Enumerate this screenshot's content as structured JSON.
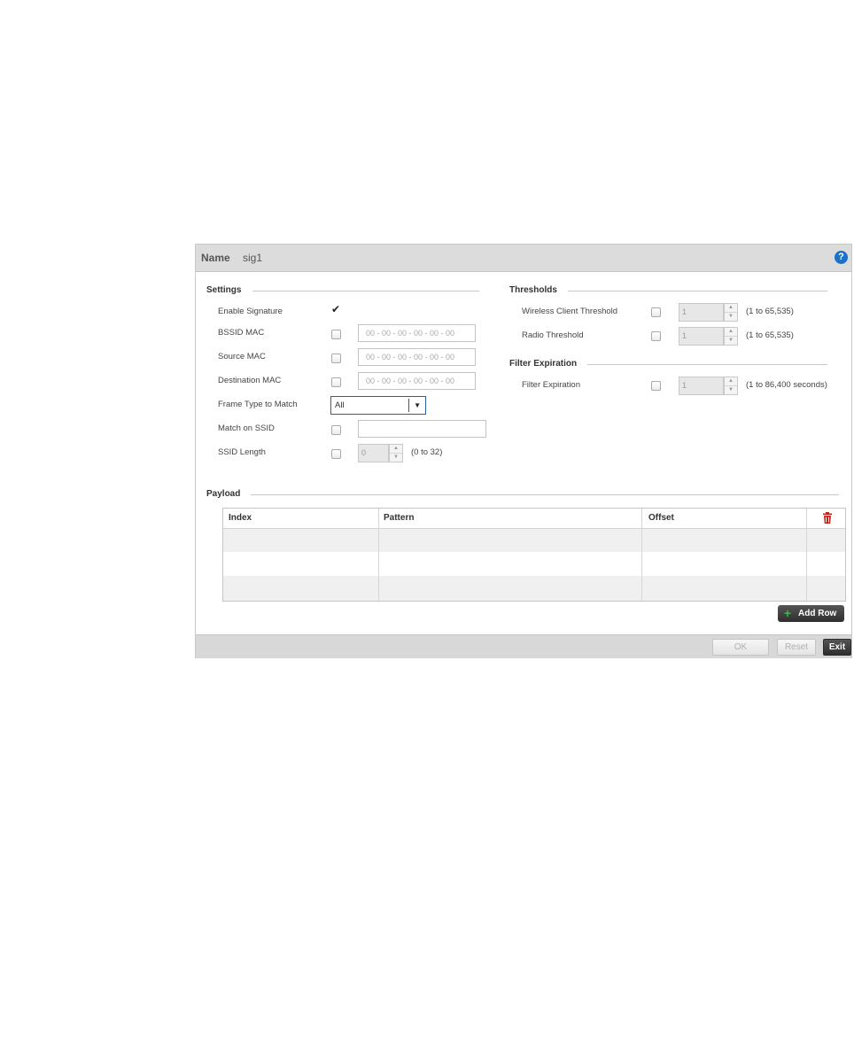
{
  "header": {
    "name_label": "Name",
    "name_value": "sig1",
    "help_icon": "?"
  },
  "settings": {
    "title": "Settings",
    "enable_signature": {
      "label": "Enable Signature",
      "checked": true
    },
    "bssid_mac": {
      "label": "BSSID MAC",
      "checked": false,
      "placeholder": "00 - 00 - 00 - 00 - 00 - 00"
    },
    "source_mac": {
      "label": "Source MAC",
      "checked": false,
      "placeholder": "00 - 00 - 00 - 00 - 00 - 00"
    },
    "destination_mac": {
      "label": "Destination MAC",
      "checked": false,
      "placeholder": "00 - 00 - 00 - 00 - 00 - 00"
    },
    "frame_type": {
      "label": "Frame Type to Match",
      "value": "All"
    },
    "match_on_ssid": {
      "label": "Match on SSID",
      "checked": false,
      "value": ""
    },
    "ssid_length": {
      "label": "SSID Length",
      "checked": false,
      "value": "0",
      "range": "(0 to 32)"
    }
  },
  "thresholds": {
    "title": "Thresholds",
    "wireless_client": {
      "label": "Wireless Client Threshold",
      "checked": false,
      "value": "1",
      "range": "(1 to 65,535)"
    },
    "radio": {
      "label": "Radio Threshold",
      "checked": false,
      "value": "1",
      "range": "(1 to 65,535)"
    }
  },
  "filter_expiration": {
    "title": "Filter Expiration",
    "field": {
      "label": "Filter Expiration",
      "checked": false,
      "value": "1",
      "range": "(1 to 86,400 seconds)"
    }
  },
  "payload": {
    "title": "Payload",
    "columns": [
      "Index",
      "Pattern",
      "Offset"
    ],
    "delete_icon": "trash-icon",
    "add_row_label": "Add Row"
  },
  "footer": {
    "ok_label": "OK",
    "reset_label": "Reset",
    "exit_label": "Exit"
  },
  "colors": {
    "accent": "#1a73c8",
    "add_icon": "#3cb54a",
    "delete_icon": "#c0281e"
  }
}
